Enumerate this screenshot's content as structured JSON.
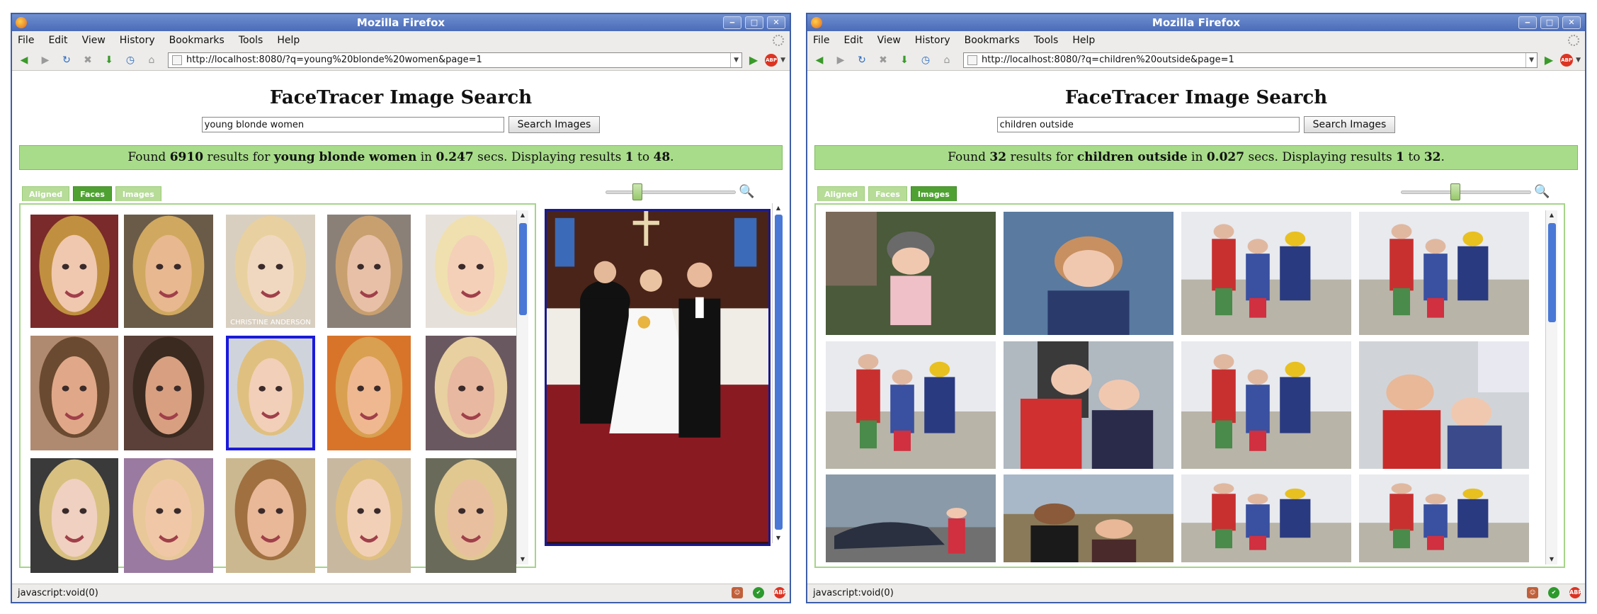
{
  "browser": {
    "title": "Mozilla Firefox",
    "menu": [
      "File",
      "Edit",
      "View",
      "History",
      "Bookmarks",
      "Tools",
      "Help"
    ],
    "status_text": "javascript:void(0)",
    "adblock_label": "ABP"
  },
  "left": {
    "url": "http://localhost:8080/?q=young%20blonde%20women&page=1",
    "page_title": "FaceTracer Image Search",
    "query": "young blonde women",
    "search_button": "Search Images",
    "results": {
      "prefix": "Found ",
      "count": "6910",
      "mid1": " results for ",
      "query": "young blonde women",
      "mid2": " in ",
      "secs": "0.247",
      "mid3": " secs. Displaying results ",
      "from": "1",
      "mid4": " to ",
      "to": "48",
      "suffix": "."
    },
    "tabs": [
      "Aligned",
      "Faces",
      "Images"
    ],
    "active_tab": "Faces",
    "watermark": "CHRISTINE ANDERSON"
  },
  "right": {
    "url": "http://localhost:8080/?q=children%20outside&page=1",
    "page_title": "FaceTracer Image Search",
    "query": "children outside",
    "search_button": "Search Images",
    "results": {
      "prefix": "Found ",
      "count": "32",
      "mid1": " results for ",
      "query": "children outside",
      "mid2": " in ",
      "secs": "0.027",
      "mid3": " secs. Displaying results ",
      "from": "1",
      "mid4": " to ",
      "to": "32",
      "suffix": "."
    },
    "tabs": [
      "Aligned",
      "Faces",
      "Images"
    ],
    "active_tab": "Images"
  },
  "colors": {
    "title_blue": "#4a6bb8",
    "result_green": "#a8dc8a",
    "tab_active": "#4fa232",
    "tab_inactive": "#b6dc98",
    "selection_blue": "#1a1adc",
    "scrollbar_blue": "#4a78d6"
  },
  "slider_level": 0.5
}
